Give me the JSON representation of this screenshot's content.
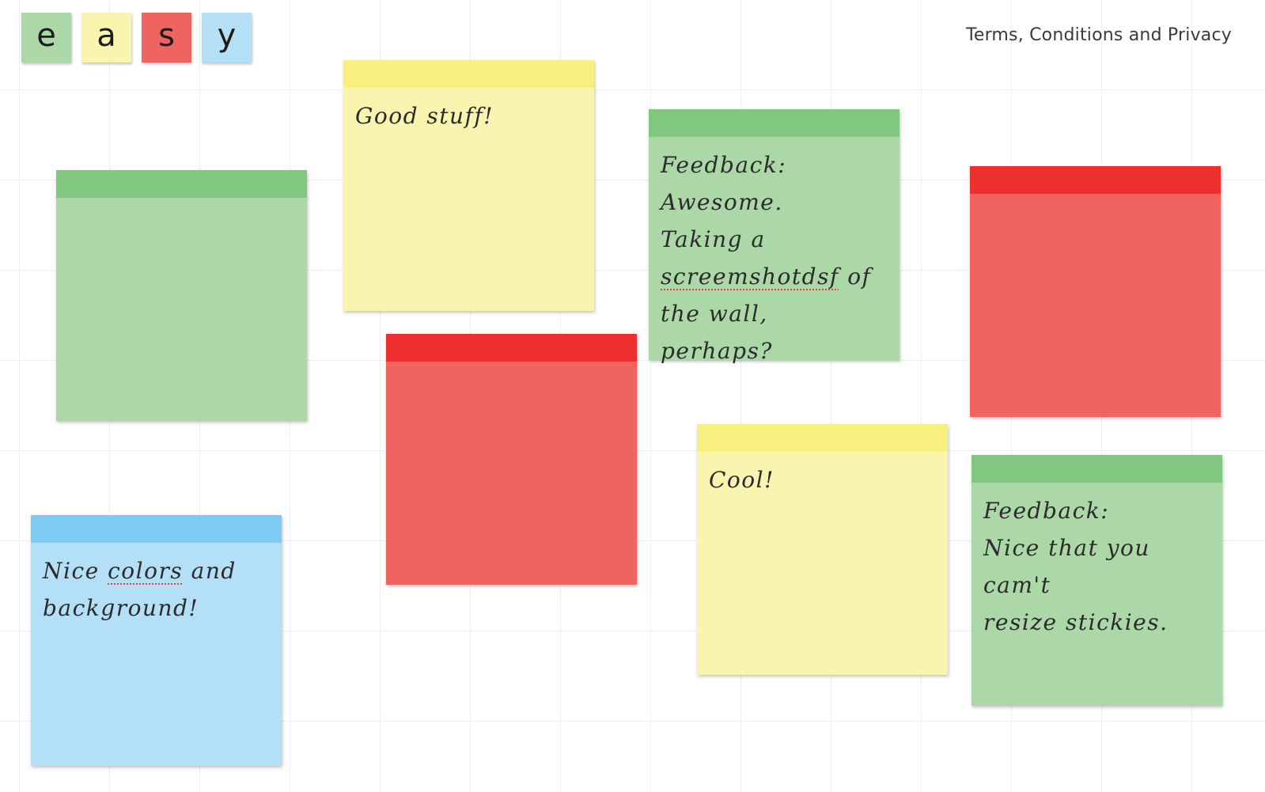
{
  "logo": {
    "letters": [
      "e",
      "a",
      "s",
      "y"
    ]
  },
  "header": {
    "terms_link": "Terms, Conditions and Privacy"
  },
  "colors": {
    "green": "#acd8a8",
    "green_bar": "#82c77f",
    "yellow": "#f9f5b1",
    "yellow_bar": "#f7f080",
    "red": "#ef6361",
    "red_bar": "#ed2f2f",
    "blue": "#b3e0f7",
    "blue_bar": "#7dcbf2"
  },
  "stickies": [
    {
      "color": "green",
      "text": ""
    },
    {
      "color": "yellow",
      "text": "Good stuff!"
    },
    {
      "color": "green",
      "lines": [
        "Feedback:",
        "Awesome.",
        "Taking a",
        "of",
        "the wall, perhaps?"
      ],
      "misspelled": "screemshotdsf"
    },
    {
      "color": "red",
      "text": ""
    },
    {
      "color": "red",
      "text": ""
    },
    {
      "color": "yellow",
      "text": "Cool!"
    },
    {
      "color": "green",
      "lines": [
        "Feedback:",
        "Nice that you cam't",
        "resize stickies."
      ]
    },
    {
      "color": "blue",
      "parts": [
        "Nice",
        "colors",
        "and",
        "background!"
      ]
    }
  ]
}
